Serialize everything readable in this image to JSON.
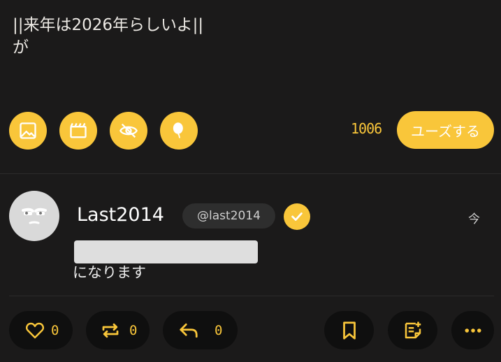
{
  "composer": {
    "text": "||来年は2026年らしいよ||\nが",
    "char_count": "1006",
    "post_button_label": "ユーズする",
    "tools": [
      {
        "icon": "image-icon"
      },
      {
        "icon": "video-icon"
      },
      {
        "icon": "eye-off-icon"
      },
      {
        "icon": "balloon-icon"
      }
    ]
  },
  "post": {
    "display_name": "Last2014",
    "handle": "@last2014",
    "timestamp": "今",
    "text": "になります",
    "actions": {
      "like_count": "0",
      "repost_count": "0",
      "reply_count": "0"
    }
  },
  "colors": {
    "background": "#1b1a1a",
    "accent": "#f9c63a",
    "pill": "#0f0f0f"
  }
}
